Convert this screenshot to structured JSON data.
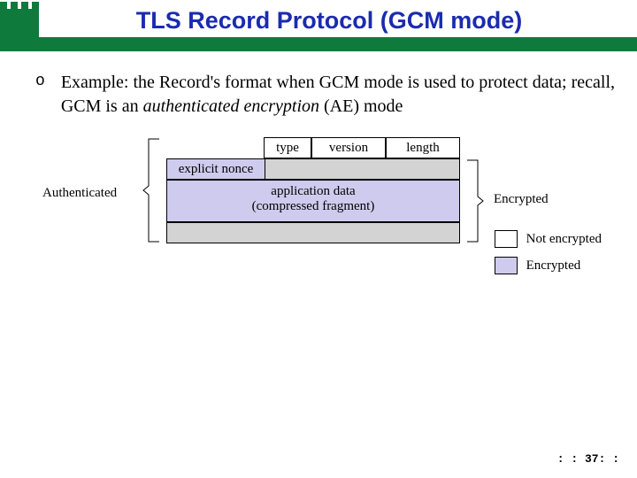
{
  "title": "TLS Record Protocol (GCM mode)",
  "bullet": {
    "marker": "o",
    "text_pre": "Example: the Record's format when GCM mode is used to protect data; recall, GCM is an ",
    "italic": "authenticated encryption",
    "text_post": " (AE) mode"
  },
  "boxes": {
    "type": "type",
    "version": "version",
    "length": "length",
    "explicit_nonce": "explicit nonce",
    "app_line1": "application data",
    "app_line2": "(compressed fragment)"
  },
  "labels": {
    "auth": "Authenticated",
    "enc": "Encrypted"
  },
  "legend": {
    "not_enc": "Not encrypted",
    "enc": "Encrypted"
  },
  "page": ": : 37: :",
  "colors": {
    "green": "#0e7a3b",
    "blue_title": "#1b2bae",
    "purple": "#cfcbee"
  }
}
